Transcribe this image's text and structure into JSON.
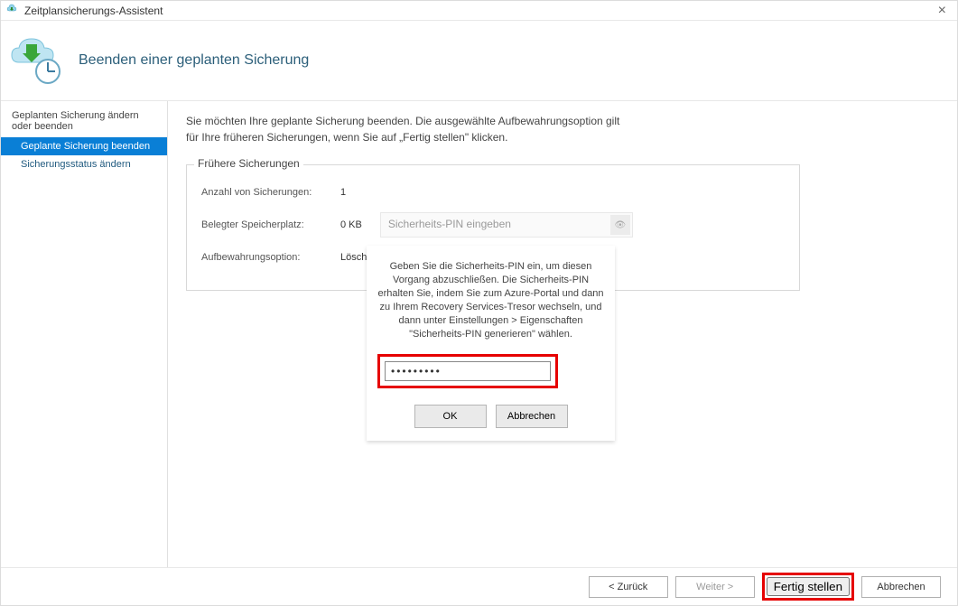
{
  "window": {
    "title": "Zeitplansicherungs-Assistent"
  },
  "header": {
    "title": "Beenden einer geplanten Sicherung"
  },
  "sidebar": {
    "heading": "Geplanten Sicherung ändern oder beenden",
    "items": [
      {
        "label": "Geplante Sicherung beenden",
        "selected": true
      },
      {
        "label": "Sicherungsstatus ändern",
        "selected": false
      }
    ]
  },
  "main": {
    "intro_line1": "Sie möchten Ihre geplante Sicherung beenden. Die ausgewählte Aufbewahrungsoption gilt",
    "intro_line2": "für Ihre früheren Sicherungen, wenn Sie auf „Fertig stellen\" klicken."
  },
  "group": {
    "legend": "Frühere Sicherungen",
    "rows": {
      "count_label": "Anzahl von Sicherungen:",
      "count_value": "1",
      "storage_label": "Belegter Speicherplatz:",
      "storage_value": "0 KB",
      "retention_label": "Aufbewahrungsoption:",
      "retention_value": "Löschen"
    }
  },
  "pin_field": {
    "placeholder": "Sicherheits-PIN eingeben"
  },
  "dialog": {
    "text": "Geben Sie die Sicherheits-PIN ein, um diesen Vorgang abzuschließen. Die Sicherheits-PIN erhalten Sie, indem Sie zum Azure-Portal und dann zu Ihrem Recovery Services-Tresor wechseln, und dann unter Einstellungen > Eigenschaften \"Sicherheits-PIN generieren\" wählen.",
    "input_value": "•••••••••",
    "ok": "OK",
    "cancel": "Abbrechen"
  },
  "footer": {
    "back": "<  Zurück",
    "next": "Weiter  >",
    "finish": "Fertig stellen",
    "cancel": "Abbrechen"
  }
}
